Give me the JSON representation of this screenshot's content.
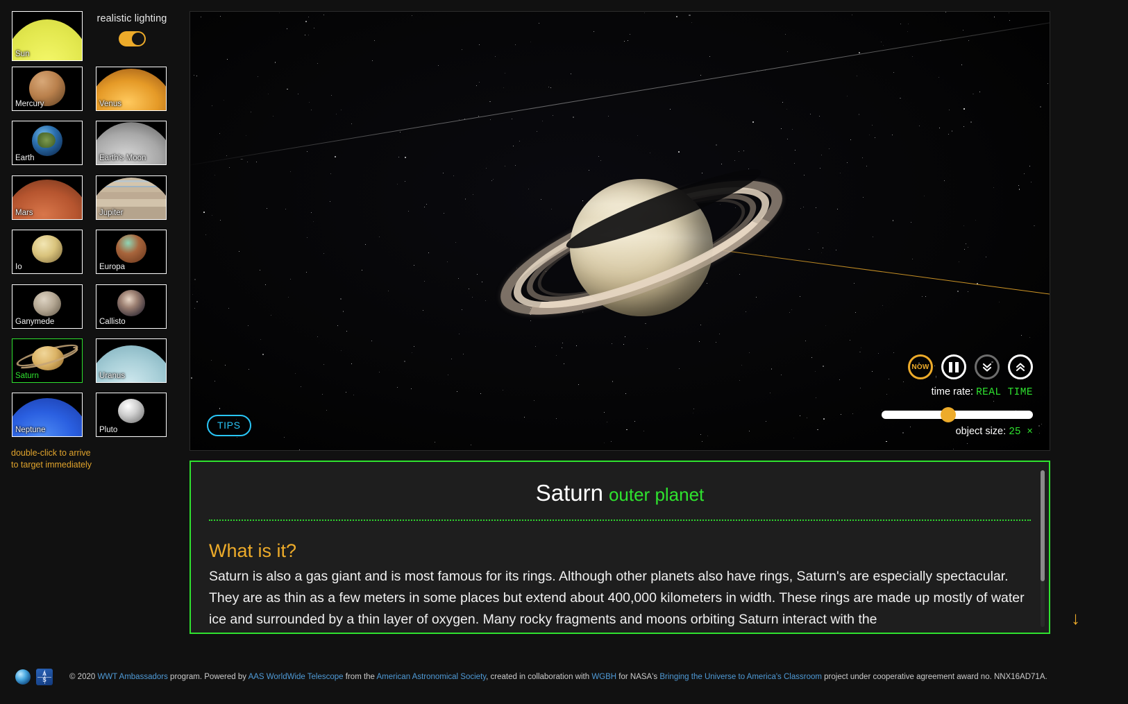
{
  "sidebar": {
    "toggle": {
      "label": "realistic lighting",
      "state": "on"
    },
    "hint_line1": "double-click to arrive",
    "hint_line2": "to target immediately",
    "selected": "Saturn",
    "tiles": [
      {
        "label": "Sun",
        "icon": "sun-thumbnail"
      },
      {
        "label": "Mercury",
        "icon": "mercury-thumbnail"
      },
      {
        "label": "Venus",
        "icon": "venus-thumbnail"
      },
      {
        "label": "Earth",
        "icon": "earth-thumbnail"
      },
      {
        "label": "Earth's Moon",
        "icon": "moon-thumbnail"
      },
      {
        "label": "Mars",
        "icon": "mars-thumbnail"
      },
      {
        "label": "Jupiter",
        "icon": "jupiter-thumbnail"
      },
      {
        "label": "Io",
        "icon": "io-thumbnail"
      },
      {
        "label": "Europa",
        "icon": "europa-thumbnail"
      },
      {
        "label": "Ganymede",
        "icon": "ganymede-thumbnail"
      },
      {
        "label": "Callisto",
        "icon": "callisto-thumbnail"
      },
      {
        "label": "Saturn",
        "icon": "saturn-thumbnail"
      },
      {
        "label": "Uranus",
        "icon": "uranus-thumbnail"
      },
      {
        "label": "Neptune",
        "icon": "neptune-thumbnail"
      },
      {
        "label": "Pluto",
        "icon": "pluto-thumbnail"
      }
    ]
  },
  "viewport": {
    "tips_label": "TIPS",
    "controls": {
      "now_label": "NOW",
      "pause_name": "pause-button",
      "slow_name": "slow-down-button",
      "fast_name": "speed-up-button"
    },
    "time_rate_label": "time rate:",
    "time_rate_value": "REAL  TIME",
    "object_size_label": "object size:",
    "object_size_value": "25 ×",
    "slider_position_percent": 44
  },
  "info": {
    "title": "Saturn",
    "subtitle": "outer planet",
    "heading": "What is it?",
    "body": "Saturn is also a gas giant and is most famous for its rings. Although other planets also have rings, Saturn's are especially spectacular. They are as thin as a few meters in some places but extend about 400,000 kilometers in width. These rings are made up mostly of water ice and surrounded by a thin layer of oxygen. Many rocky fragments and moons orbiting Saturn interact with the",
    "scroll_arrow": "↓"
  },
  "footer": {
    "copyright": "© 2020 ",
    "link1": "WWT Ambassadors",
    "t1": " program. Powered by ",
    "link2": "AAS WorldWide Telescope",
    "t2": " from the ",
    "link3": "American Astronomical Society",
    "t3": ", created in collaboration with ",
    "link4": "WGBH",
    "t4": " for NASA's ",
    "link5": "Bringing the Universe to America's Classroom",
    "t5": " project under cooperative agreement award no. NNX16AD71A.",
    "aas_a": "A",
    "aas_s": "S"
  },
  "colors": {
    "accent_orange": "#edab2a",
    "accent_green": "#2fe22f",
    "tips_blue": "#29c5f6",
    "link_blue": "#4f9ad6",
    "background": "#111111"
  }
}
